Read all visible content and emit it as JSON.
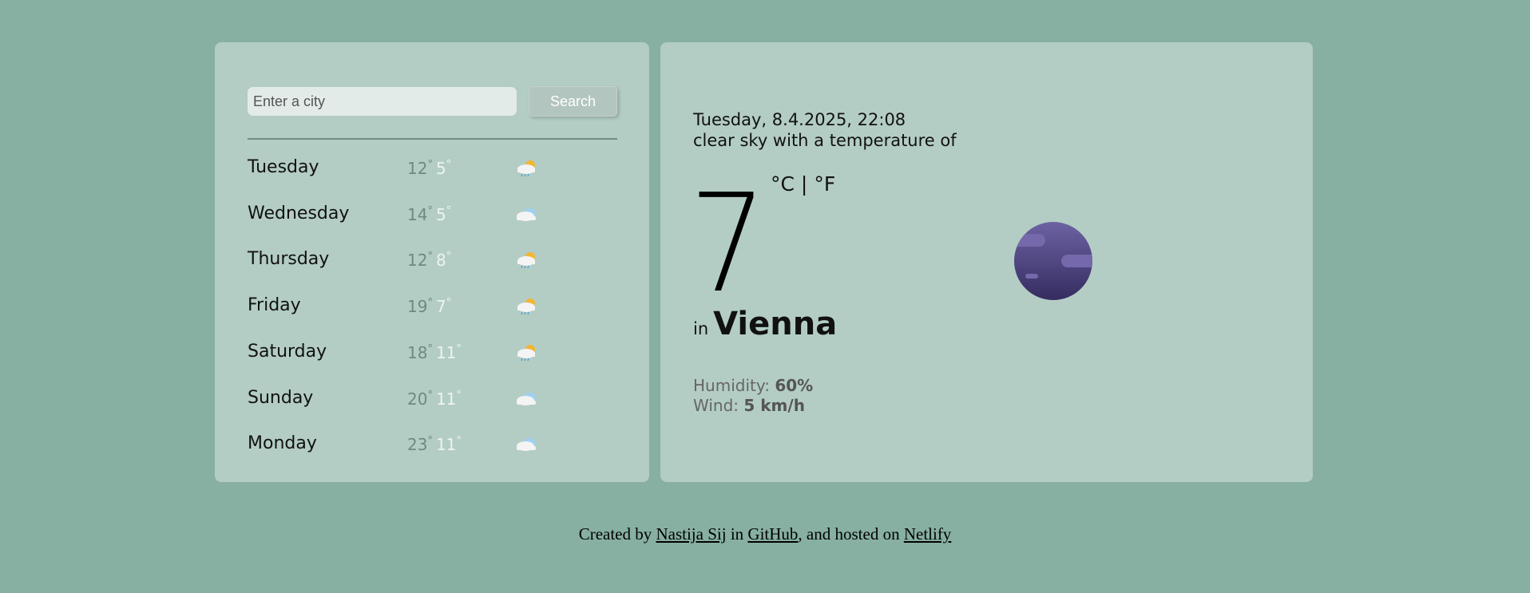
{
  "search": {
    "placeholder": "Enter a city",
    "value": "",
    "button_label": "Search"
  },
  "forecast": [
    {
      "day": "Tuesday",
      "max": "12",
      "min": "5",
      "icon": "rain-sun-icon"
    },
    {
      "day": "Wednesday",
      "max": "14",
      "min": "5",
      "icon": "cloud-icon"
    },
    {
      "day": "Thursday",
      "max": "12",
      "min": "8",
      "icon": "rain-sun-icon"
    },
    {
      "day": "Friday",
      "max": "19",
      "min": "7",
      "icon": "rain-sun-icon"
    },
    {
      "day": "Saturday",
      "max": "18",
      "min": "11",
      "icon": "rain-sun-icon"
    },
    {
      "day": "Sunday",
      "max": "20",
      "min": "11",
      "icon": "cloud-icon"
    },
    {
      "day": "Monday",
      "max": "23",
      "min": "11",
      "icon": "cloud-icon"
    }
  ],
  "degree": "°",
  "current": {
    "datetime": "Tuesday, 8.4.2025, 22:08",
    "description": "clear sky with a temperature of",
    "temperature": "7",
    "unit_c": "°C",
    "separator": "|",
    "unit_f": "°F",
    "in_label": "in",
    "city": "Vienna",
    "humidity_label": "Humidity:",
    "humidity": "60%",
    "wind_label": "Wind:",
    "wind": "5 km/h",
    "icon": "moon-icon"
  },
  "footer": {
    "created_by": "Created by",
    "author": "Nastija Sij",
    "in": "in",
    "github": "GitHub",
    "hosted": ", and hosted on",
    "netlify": "Netlify"
  }
}
